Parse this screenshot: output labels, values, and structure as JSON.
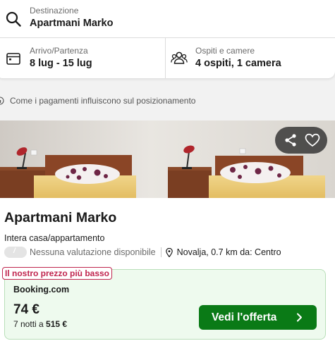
{
  "search": {
    "destination_label": "Destinazione",
    "destination_value": "Apartmani Marko",
    "dates_label": "Arrivo/Partenza",
    "dates_value": "8 lug - 15 lug",
    "guests_label": "Ospiti e camere",
    "guests_value": "4 ospiti, 1 camera"
  },
  "info": {
    "payments_text": "Come i pagamenti influiscono sul posizionamento"
  },
  "hotel": {
    "name": "Apartmani Marko",
    "type": "Intera casa/appartamento",
    "rating_badge": "/",
    "rating_text": "Nessuna valutazione disponibile",
    "location": "Novalja, 0.7 km da: Centro"
  },
  "deal": {
    "badge": "Il nostro prezzo più basso",
    "provider": "Booking.com",
    "price": "74 €",
    "nights_prefix": "7 notti a",
    "nights_total": "515 €",
    "cta_label": "Vedi l'offerta"
  },
  "icons": {
    "search": "search-icon",
    "calendar": "calendar-icon",
    "guests": "people-icon",
    "info": "info-icon",
    "share": "share-icon",
    "favorite": "heart-icon",
    "pin": "map-pin-icon",
    "chevron": "chevron-right-icon"
  },
  "colors": {
    "cta_green": "#0a7a16",
    "badge_red": "#c0254e",
    "deal_bg": "#eefaee"
  }
}
